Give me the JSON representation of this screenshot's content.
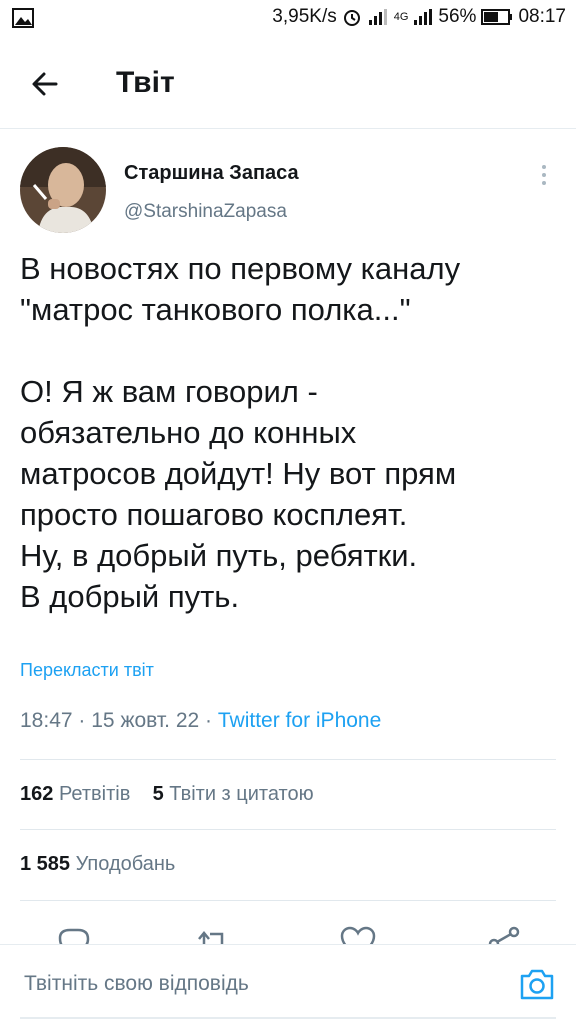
{
  "status_bar": {
    "speed": "3,95K/s",
    "network": "4G",
    "battery": "56%",
    "time": "08:17",
    "icons": [
      "image-icon",
      "alarm-icon",
      "signal-icon",
      "battery-icon"
    ]
  },
  "header": {
    "title": "Твіт",
    "back_icon": "arrow-left-icon"
  },
  "tweet": {
    "author": {
      "display_name": "Старшина Запаса",
      "handle": "@StarshinaZapasa"
    },
    "lines": [
      "В новостях по первому каналу",
      "\"матрос танкового полка...\"",
      "О! Я ж вам говорил -",
      "обязательно до конных",
      "матросов дойдут! Ну вот прям",
      "просто пошагово косплеят.",
      "Ну, в добрый путь, ребятки.",
      "В добрый путь."
    ],
    "translate_label": "Перекласти твіт",
    "time": "18:47",
    "date": "15 жовт. 22",
    "separator": "·",
    "source": "Twitter for iPhone",
    "stats": {
      "retweets_count": "162",
      "retweets_label": "Ретвітів",
      "quotes_count": "5",
      "quotes_label": "Твіти з цитатою",
      "likes_count": "1 585",
      "likes_label": "Уподобань"
    }
  },
  "actions": [
    "reply-icon",
    "retweet-icon",
    "like-icon",
    "share-icon"
  ],
  "composer": {
    "placeholder": "Твітніть свою відповідь",
    "camera_icon": "camera-icon"
  },
  "colors": {
    "accent": "#1da1f2",
    "text": "#14171a",
    "secondary": "#657786",
    "divider": "#e1e8ed"
  }
}
